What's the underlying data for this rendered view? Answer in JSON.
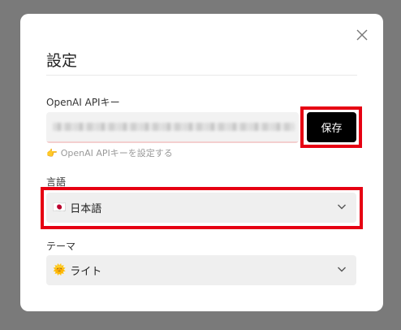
{
  "dialog": {
    "title": "設定"
  },
  "api_key": {
    "label": "OpenAI APIキー",
    "save_label": "保存",
    "hint_icon": "👉",
    "hint_text": "OpenAI APIキーを設定する"
  },
  "language": {
    "label": "言語",
    "icon": "🇯🇵",
    "selected": "日本語"
  },
  "theme": {
    "label": "テーマ",
    "icon": "🌞",
    "selected": "ライト"
  },
  "colors": {
    "highlight": "#e60012",
    "button_bg": "#000000",
    "overlay": "#7a7a7a"
  }
}
